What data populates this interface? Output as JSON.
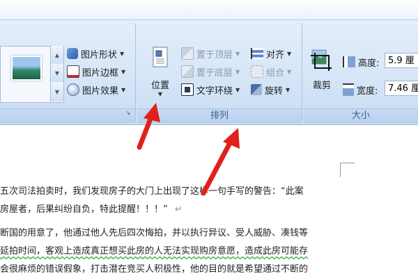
{
  "ribbon": {
    "styles_group": {
      "shape_label": "图片形状",
      "border_label": "图片边框",
      "effects_label": "图片效果"
    },
    "arrange_group": {
      "label": "排列",
      "position_label": "位置",
      "bring_front_label": "置于顶层",
      "send_back_label": "置于底层",
      "wrap_label": "文字环绕",
      "align_label": "对齐",
      "group_label": "组合",
      "rotate_label": "旋转"
    },
    "size_group": {
      "label": "大小",
      "crop_label": "裁剪",
      "height_label": "高度:",
      "height_value": "5.9 厘",
      "width_label": "宽度:",
      "width_value": "7.46 厘"
    }
  },
  "document": {
    "lines": [
      "五次司法拍卖时，我们发现房子的大门上出现了这样一句手写的警告：“此案",
      "房屋者，后果纠纷自负，特此提醒！！！”",
      "断国的用意了，他通过他人先后四次悔拍，并以执行异议、受人威胁、凑钱等",
      "延拍时间，客观上造成真正想买此房的人无法实现购房意愿，造成此房可能存",
      "会很麻烦的错误假象，打击潜在竞买人积极性，他的目的就是希望通过不断的"
    ]
  },
  "colors": {
    "ribbon_bg": "#d6e5f7",
    "group_label": "#3a5f94",
    "arrow_red": "#e0201b"
  }
}
